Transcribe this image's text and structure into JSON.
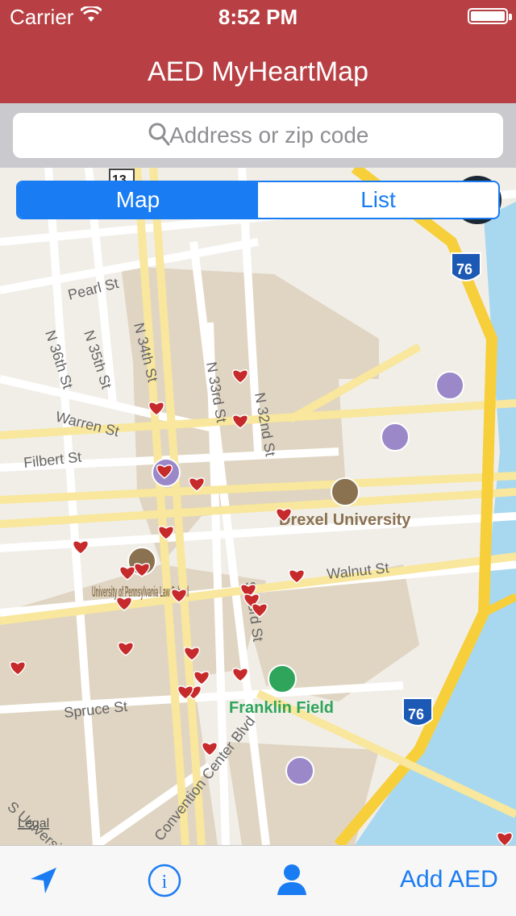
{
  "status_bar": {
    "carrier": "Carrier",
    "time": "8:52 PM"
  },
  "nav": {
    "title": "AED MyHeartMap"
  },
  "search": {
    "placeholder": "Address or zip code"
  },
  "segment": {
    "map_label": "Map",
    "list_label": "List",
    "selected": "Map"
  },
  "map": {
    "streets": [
      "Pearl St",
      "N 36th St",
      "N 35th St",
      "N 34th St",
      "N 33rd St",
      "N 32nd St",
      "Warren St",
      "Filbert St",
      "Walnut St",
      "Spruce St",
      "S 33rd St",
      "S University",
      "Convention Center Blvd"
    ],
    "places": [
      "Drexel University",
      "University of Pennsylvania Law School",
      "Franklin Field"
    ],
    "highway_shields": [
      "76",
      "76",
      "13"
    ],
    "legal": "Legal",
    "marker_icon": "heart-marker-icon",
    "colors": {
      "accent": "#b84044",
      "heart": "#c62a2a",
      "water": "#a8d8f0",
      "highway": "#f7cf3a",
      "campus": "#e0d5c2"
    }
  },
  "tabbar": {
    "add_aed_label": "Add AED"
  }
}
